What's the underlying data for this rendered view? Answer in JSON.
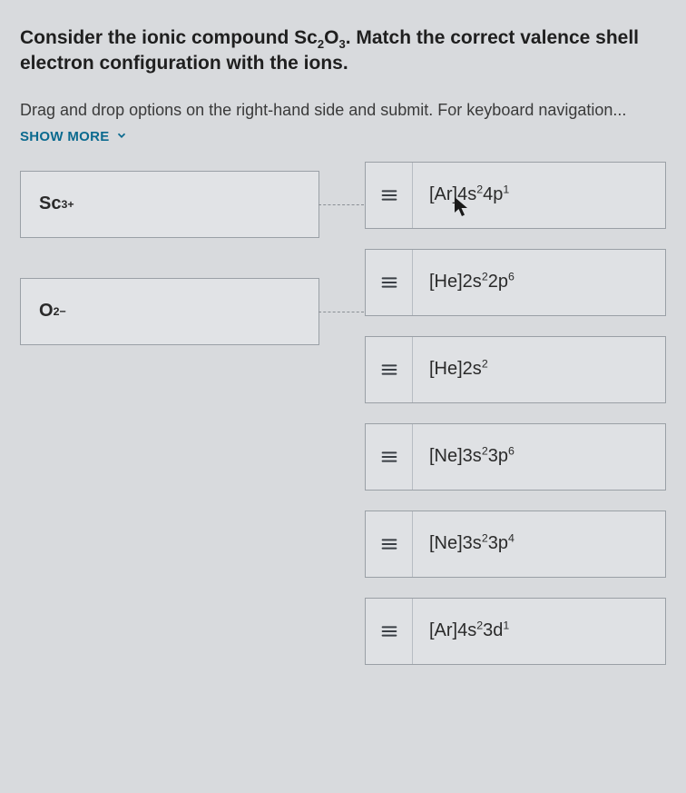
{
  "question_html": "Consider the ionic compound Sc<sub>2</sub>O<sub>3</sub>. Match the correct valence shell electron configuration with the ions.",
  "instructions": "Drag and drop options on the right-hand side and submit. For keyboard navigation...",
  "show_more_label": "SHOW MORE",
  "targets": [
    {
      "html": "Sc<sup>3+</sup>"
    },
    {
      "html": "O<sup>2−</sup>"
    }
  ],
  "options": [
    {
      "html": "[Ar]4s<sup>2</sup>4p<sup>1</sup>"
    },
    {
      "html": "[He]2s<sup>2</sup>2p<sup>6</sup>"
    },
    {
      "html": "[He]2s<sup>2</sup>"
    },
    {
      "html": "[Ne]3s<sup>2</sup>3p<sup>6</sup>"
    },
    {
      "html": "[Ne]3s<sup>2</sup>3p<sup>4</sup>"
    },
    {
      "html": "[Ar]4s<sup>2</sup>3d<sup>1</sup>"
    }
  ]
}
